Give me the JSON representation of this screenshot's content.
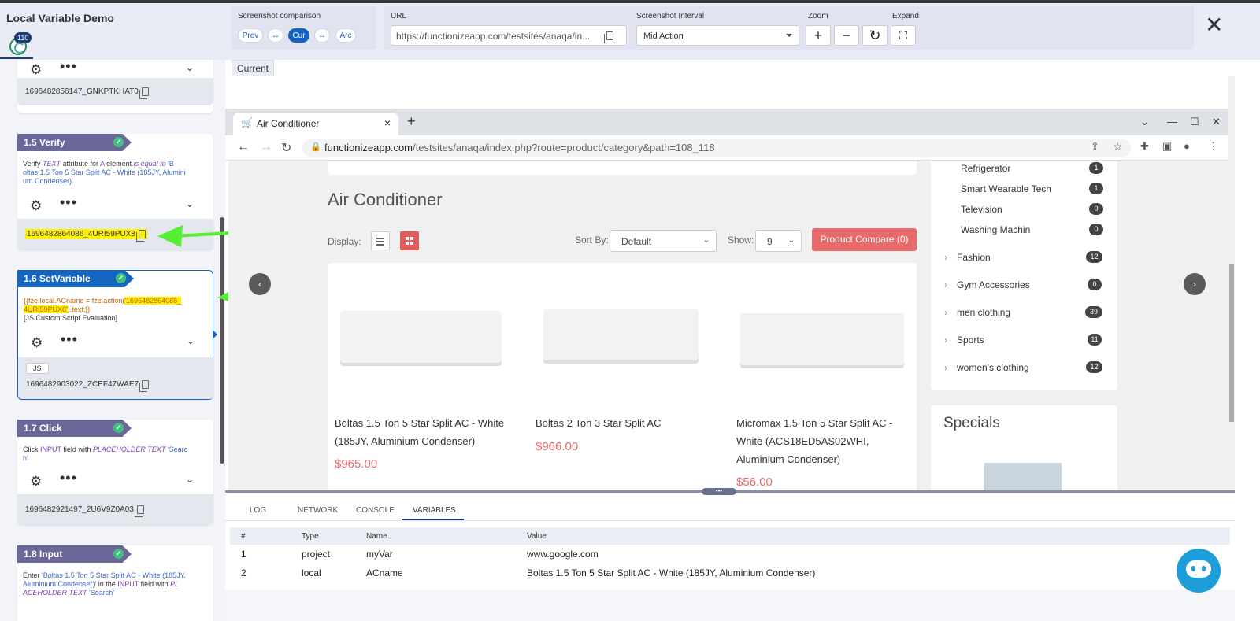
{
  "app": {
    "title": "Local Variable Demo",
    "badge": "110"
  },
  "header": {
    "comparison_label": "Screenshot comparison",
    "prev": "Prev",
    "swap1": "↔",
    "cur": "Cur",
    "swap2": "↔",
    "arc": "Arc",
    "url_label": "URL",
    "url_value": "https://functionizeapp.com/testsites/anaqa/in...",
    "interval_label": "Screenshot Interval",
    "interval_value": "Mid Action",
    "zoom_label": "Zoom",
    "expand_label": "Expand",
    "zoom_in": "+",
    "zoom_out": "−",
    "reset": "↻",
    "expand": "⛶",
    "close": "✕"
  },
  "steps": {
    "s0": {
      "id": "1696482856147_GNKPTKHAT0"
    },
    "s15": {
      "title": "1.5 Verify",
      "d1": "Verify ",
      "d2": "TEXT",
      "d3": " attribute for ",
      "d4": "A",
      "d5": " element ",
      "d6": "is equal to",
      "d7": " 'B",
      "d8": "oltas 1.5 Ton 5 Star Split AC - White (185JY, Alumini",
      "d9": "um Condenser)'",
      "id": "1696482864086_4URI59PUX8"
    },
    "s16": {
      "title": "1.6 SetVariable",
      "c1": "{{fze.local.ACname = fze.action(",
      "c2": "'1696482864086_",
      "c3": "4URI59PUX8'",
      "c4": ").text;}}",
      "c5": "[JS Custom Script Evaluation]",
      "tag": "JS",
      "id": "1696482903022_ZCEF47WAE7"
    },
    "s17": {
      "title": "1.7 Click",
      "d1": "Click ",
      "d2": "INPUT",
      "d3": " field with ",
      "d4": "PLACEHOLDER TEXT",
      "d5": " 'Searc",
      "d6": "h'",
      "id": "1696482921497_2U6V9Z0A03"
    },
    "s18": {
      "title": "1.8 Input",
      "d1": "Enter ",
      "d2": "'Boltas 1.5 Ton 5 Star Split AC - White (185JY,",
      "d3": "Aluminium Condenser)'",
      "d4": " in the ",
      "d5": "INPUT",
      "d6": " field with ",
      "d7": "PL",
      "d8": "ACEHOLDER TEXT",
      "d9": " 'Search'"
    }
  },
  "viewer": {
    "tab": "Current"
  },
  "browser": {
    "tab_title": "Air Conditioner",
    "url_host": "functionizeapp.com",
    "url_rest": "/testsites/anaqa/index.php?route=product/category&path=108_118"
  },
  "shop": {
    "category_title": "Air Conditioner",
    "display_label": "Display:",
    "sort_label": "Sort By:",
    "sort_value": "Default",
    "show_label": "Show:",
    "show_value": "9",
    "compare_button": "Product Compare (0)",
    "products": [
      {
        "name": "Boltas 1.5 Ton 5 Star Split AC - White (185JY, Aluminium Condenser)",
        "price": "$965.00"
      },
      {
        "name": "Boltas 2 Ton 3 Star Split AC",
        "price": "$966.00"
      },
      {
        "name": "Micromax 1.5 Ton 5 Star Split AC - White (ACS18ED5AS02WHI, Aluminium Condenser)",
        "price": "$56.00"
      }
    ],
    "categories": [
      {
        "name": "Refrigerator",
        "count": "1"
      },
      {
        "name": "Smart Wearable Tech",
        "count": "1"
      },
      {
        "name": "Television",
        "count": "0"
      },
      {
        "name": "Washing Machin",
        "count": "0"
      },
      {
        "name": "Fashion",
        "count": "12"
      },
      {
        "name": "Gym Accessories",
        "count": "0"
      },
      {
        "name": "men clothing",
        "count": "39"
      },
      {
        "name": "Sports",
        "count": "11"
      },
      {
        "name": "women's clothing",
        "count": "12"
      }
    ],
    "specials_title": "Specials"
  },
  "bottom": {
    "tabs": [
      "LOG",
      "NETWORK",
      "CONSOLE",
      "VARIABLES"
    ],
    "headers": [
      "#",
      "Type",
      "Name",
      "Value"
    ],
    "rows": [
      {
        "num": "1",
        "type": "project",
        "name": "myVar",
        "value": "www.google.com"
      },
      {
        "num": "2",
        "type": "local",
        "name": "ACname",
        "value": "Boltas 1.5 Ton 5 Star Split AC - White (185JY, Aluminium Condenser)"
      }
    ]
  }
}
